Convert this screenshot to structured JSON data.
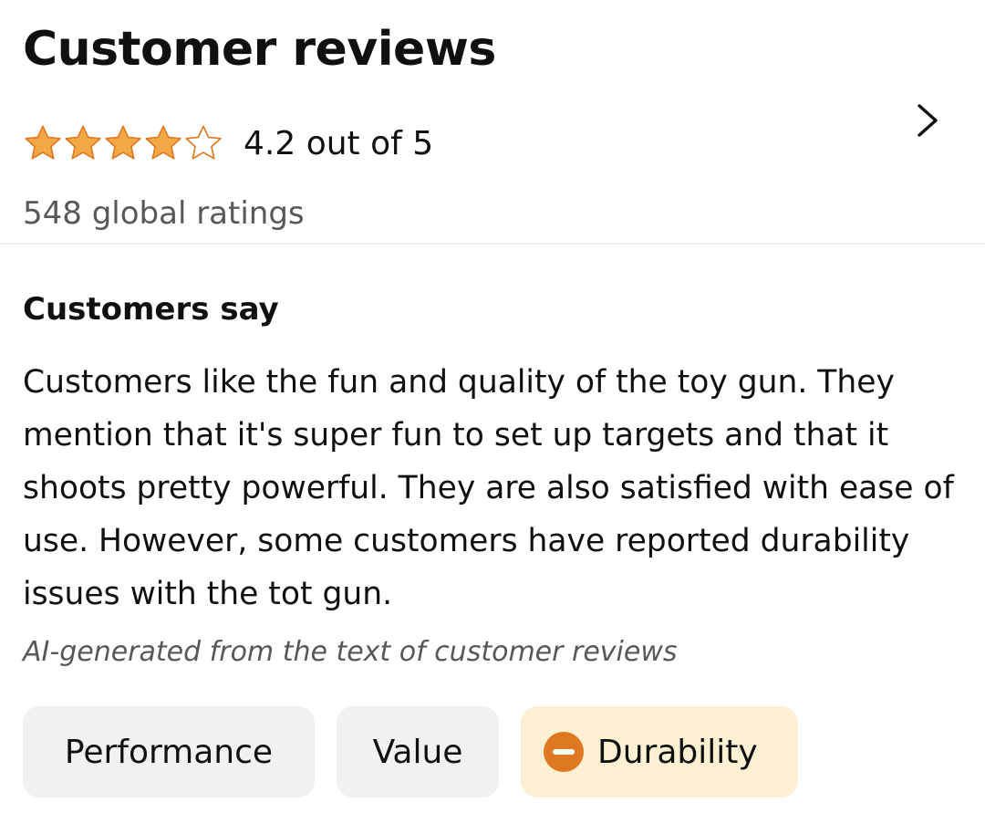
{
  "section": {
    "title": "Customer reviews",
    "rating_text": "4.2 out of 5",
    "rating_value": 4.2,
    "rating_max": 5,
    "global_ratings": "548 global ratings",
    "chevron_icon": "chevron-right-icon"
  },
  "customers_say": {
    "heading": "Customers say",
    "summary": "Customers like the fun and quality of the toy gun. They mention that it's super fun to set up targets and that it shoots pretty powerful. They are also satisfied with ease of use. However, some customers have reported durability issues with the tot gun.",
    "ai_note": "AI-generated from the text of customer reviews"
  },
  "aspects": [
    {
      "label": "Performance",
      "sentiment": "neutral"
    },
    {
      "label": "Value",
      "sentiment": "neutral"
    },
    {
      "label": "Durability",
      "sentiment": "negative",
      "icon": "minus-circle-icon"
    }
  ],
  "colors": {
    "star_fill": "#f3a847",
    "star_outline": "#de7921",
    "negative_icon": "#de7921",
    "chip_neutral_bg": "#eff1f2",
    "chip_negative_bg": "#fdf0d2",
    "secondary_text": "#565959"
  }
}
